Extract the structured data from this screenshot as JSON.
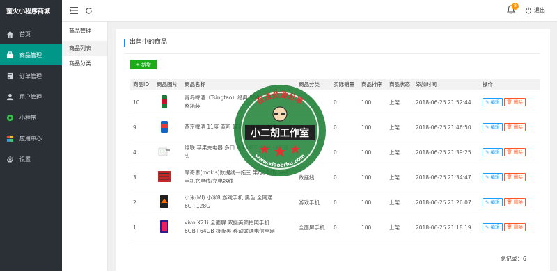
{
  "app": {
    "brand": "萤火小程序商城"
  },
  "sidebar": {
    "items": [
      {
        "label": "首页",
        "icon": "home-icon"
      },
      {
        "label": "商品管理",
        "icon": "goods-icon"
      },
      {
        "label": "订单管理",
        "icon": "order-icon"
      },
      {
        "label": "用户管理",
        "icon": "user-icon"
      },
      {
        "label": "小程序",
        "icon": "miniprogram-icon"
      },
      {
        "label": "应用中心",
        "icon": "apps-icon"
      },
      {
        "label": "设置",
        "icon": "gear-icon"
      }
    ],
    "active_index": 1
  },
  "subnav": {
    "title": "商品管理",
    "items": [
      {
        "label": "商品列表"
      },
      {
        "label": "商品分类"
      }
    ]
  },
  "topbar": {
    "badge_count": "8",
    "logout_label": "退出"
  },
  "main": {
    "title": "出售中的商品",
    "add_button": "+ 新增",
    "total_label": "总记录：6"
  },
  "table": {
    "headers": [
      "商品ID",
      "商品图片",
      "商品名称",
      "商品分类",
      "实际销量",
      "商品排序",
      "商品状态",
      "添加时间",
      "操作"
    ],
    "rows": [
      {
        "id": "10",
        "name": "青岛啤酒（Tsingtao）经典 500ml*12听 大罐整箱装",
        "category": "",
        "sales": "0",
        "sort": "100",
        "status": "上架",
        "time": "2018-06-25 21:52:44"
      },
      {
        "id": "9",
        "name": "燕京啤酒 11度 蓝听 罐装 特制精品啤酒",
        "category": "",
        "sales": "0",
        "sort": "100",
        "status": "上架",
        "time": "2018-06-25 21:46:50"
      },
      {
        "id": "4",
        "name": "绿联 苹果充电器 多口 3.4A双口快充小米5插头",
        "category": "",
        "sales": "0",
        "sort": "100",
        "status": "上架",
        "time": "2018-06-25 21:39:25"
      },
      {
        "id": "3",
        "name": "摩奇思(mokis)数据线一拖三 果/安卓/Type-C手机充电线/充电器线",
        "category": "数据线",
        "sales": "0",
        "sort": "100",
        "status": "上架",
        "time": "2018-06-25 21:34:47"
      },
      {
        "id": "2",
        "name": "小米(MI) 小米8 游戏手机 黑色 全网通 6G+128G",
        "category": "游戏手机",
        "sales": "0",
        "sort": "100",
        "status": "上架",
        "time": "2018-06-25 21:26:07"
      },
      {
        "id": "1",
        "name": "vivo X21i 全面屏 双摄美颜拍照手机 6GB+64GB 极夜黑 移动联通电信全网",
        "category": "全面屏手机",
        "sales": "0",
        "sort": "100",
        "status": "上架",
        "time": "2018-06-25 21:18:19"
      }
    ],
    "edit_label": "编辑",
    "delete_label": "删除"
  },
  "watermark": {
    "top_text": "百法资源分享",
    "main_text": "小二胡工作室",
    "url": "www.xiaoerhu.com"
  },
  "colors": {
    "accent": "#009688",
    "sidebar": "#2b2f36",
    "status_green": "#1aad19",
    "edit_blue": "#1e9fff",
    "delete_red": "#ff5722",
    "watermark_red": "#e02020",
    "watermark_green": "#1a7d32"
  }
}
